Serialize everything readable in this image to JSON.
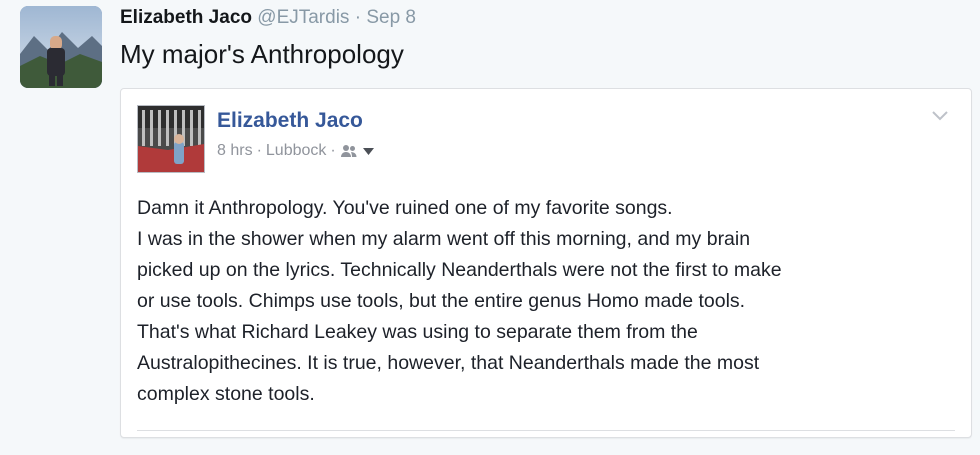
{
  "tweet": {
    "author_name": "Elizabeth Jaco",
    "author_handle": "@EJTardis",
    "separator": "·",
    "timestamp": "Sep 8",
    "text": "My major's Anthropology"
  },
  "facebook_post": {
    "author_name": "Elizabeth Jaco",
    "time": "8 hrs",
    "separator": "·",
    "location": "Lubbock",
    "audience_icon": "friends-icon",
    "lines": [
      "Damn it Anthropology. You've ruined one of my favorite songs.",
      "I was in the shower when my alarm went off this morning, and my brain",
      "picked up on the lyrics. Technically Neanderthals were not the first to make",
      "or use tools. Chimps use tools, but the entire genus Homo made tools.",
      "That's what Richard Leakey was using to separate them from the",
      "Australopithecines. It is true, however, that Neanderthals made the most",
      "complex stone tools."
    ]
  },
  "colors": {
    "background": "#f5f8fa",
    "fb_link": "#365899",
    "meta_gray": "#90949c",
    "twitter_gray": "#8899a6"
  }
}
